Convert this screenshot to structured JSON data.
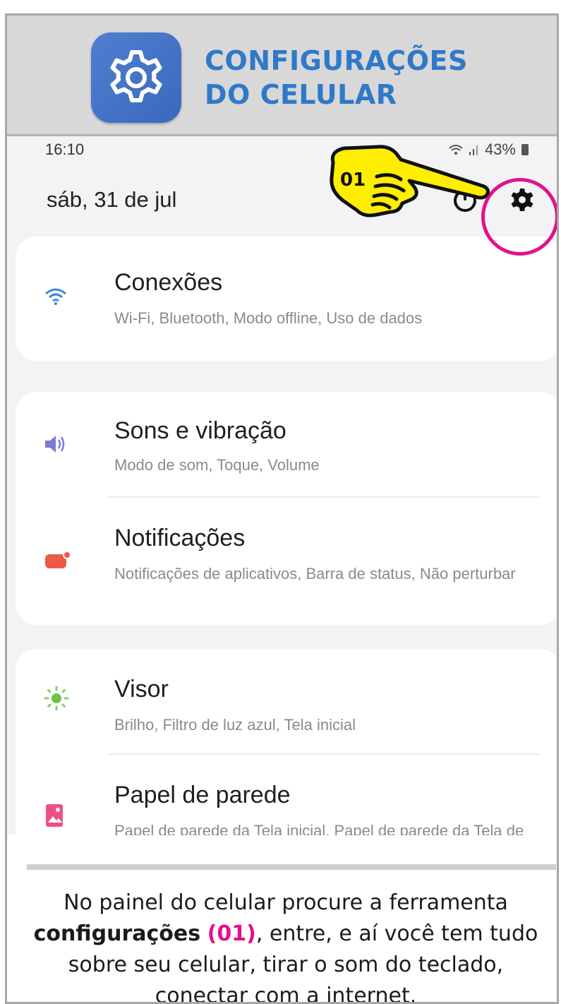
{
  "banner": {
    "title_line1": "CONFIGURAÇÕES",
    "title_line2": "DO CELULAR",
    "icon": "settings-gear-icon",
    "title_color": "#2f79c9"
  },
  "status_bar": {
    "time": "16:10",
    "battery": "43%",
    "icons": [
      "wifi-icon",
      "signal-icon",
      "battery-icon"
    ]
  },
  "quick_panel": {
    "date": "sáb, 31 de jul",
    "power_icon": "power-icon",
    "settings_icon": "gear-icon"
  },
  "annotation": {
    "label": "01",
    "highlight_color": "#e2118e"
  },
  "settings_groups": [
    {
      "items": [
        {
          "title": "Conexões",
          "subtitle": "Wi-Fi, Bluetooth, Modo offline, Uso de dados",
          "icon": "wifi-icon"
        }
      ]
    },
    {
      "items": [
        {
          "title": "Sons e vibração",
          "subtitle": "Modo de som, Toque, Volume",
          "icon": "volume-icon"
        },
        {
          "title": "Notificações",
          "subtitle": "Notificações de aplicativos, Barra de status, Não perturbar",
          "icon": "notification-icon"
        }
      ]
    },
    {
      "items": [
        {
          "title": "Visor",
          "subtitle": "Brilho, Filtro de luz azul, Tela inicial",
          "icon": "brightness-icon"
        },
        {
          "title": "Papel de parede",
          "subtitle": "Papel de parede da Tela inicial, Papel de parede da Tela de bloqueio",
          "icon": "wallpaper-icon"
        }
      ]
    }
  ],
  "caption": {
    "part1": "No painel do celular procure a ferramenta ",
    "bold": "configurações",
    "num": "(01)",
    "part2": ", entre, e aí você tem tudo sobre seu celular, tirar o som do teclado, conectar com a internet."
  }
}
